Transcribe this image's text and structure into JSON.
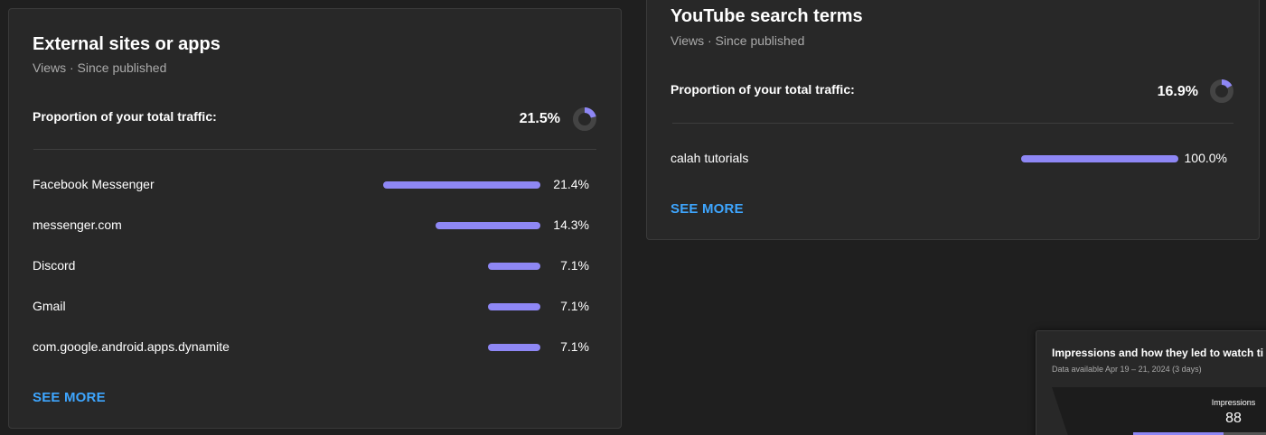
{
  "external": {
    "title": "External sites or apps",
    "subtitle": "Views · Since published",
    "proportion_label": "Proportion of your total traffic:",
    "proportion_value": "21.5%",
    "proportion_fraction": 0.215,
    "rows": [
      {
        "label": "Facebook Messenger",
        "value": "21.4%",
        "fraction": 1.0
      },
      {
        "label": "messenger.com",
        "value": "14.3%",
        "fraction": 0.668
      },
      {
        "label": "Discord",
        "value": "7.1%",
        "fraction": 0.332
      },
      {
        "label": "Gmail",
        "value": "7.1%",
        "fraction": 0.332
      },
      {
        "label": "com.google.android.apps.dynamite",
        "value": "7.1%",
        "fraction": 0.332
      }
    ],
    "see_more": "SEE MORE"
  },
  "search": {
    "title": "YouTube search terms",
    "subtitle": "Views · Since published",
    "proportion_label": "Proportion of your total traffic:",
    "proportion_value": "16.9%",
    "proportion_fraction": 0.169,
    "rows": [
      {
        "label": "calah tutorials",
        "value": "100.0%",
        "fraction": 1.0
      }
    ],
    "see_more": "SEE MORE"
  },
  "impressions": {
    "title": "Impressions and how they led to watch ti",
    "subtitle": "Data available Apr 19 – 21, 2024 (3 days)",
    "metric_label": "Impressions",
    "metric_value": "88"
  },
  "colors": {
    "bar": "#8e87f5",
    "link": "#3ea6ff",
    "donut_track": "#444444"
  }
}
